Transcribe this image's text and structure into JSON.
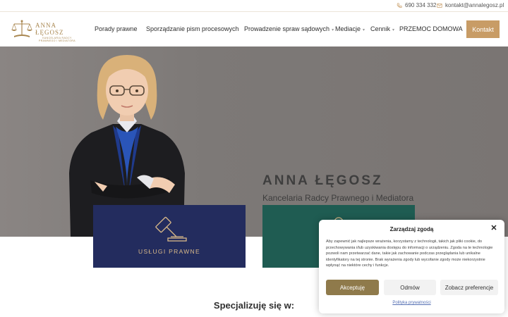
{
  "topbar": {
    "phone": "690 334 332",
    "email": "kontakt@annalegosz.pl"
  },
  "logo": {
    "name": "ANNA ŁĘGOSZ",
    "subtitle": "KANCELARIA RADCY PRAWNEGO I MEDIATORA"
  },
  "nav": {
    "items": [
      {
        "label": "Porady prawne",
        "has_dropdown": false
      },
      {
        "label": "Sporządzanie pism procesowych",
        "has_dropdown": false
      },
      {
        "label": "Prowadzenie spraw sądowych",
        "has_dropdown": true
      },
      {
        "label": "Mediacje",
        "has_dropdown": true
      },
      {
        "label": "Cennik",
        "has_dropdown": true
      },
      {
        "label": "PRZEMOC DOMOWA",
        "has_dropdown": false
      }
    ],
    "contact_button": "Kontakt"
  },
  "hero": {
    "name": "ANNA ŁĘGOSZ",
    "subtitle": "Kancelaria Radcy Prawnego i Mediatora"
  },
  "cards": {
    "legal_services": "USŁUGI PRAWNE"
  },
  "section": {
    "specialize_heading": "Specjalizuję się w:"
  },
  "cookie": {
    "title": "Zarządzaj zgodą",
    "body": "Aby zapewnić jak najlepsze wrażenia, korzystamy z technologii, takich jak pliki cookie, do przechowywania i/lub uzyskiwania dostępu do informacji o urządzeniu. Zgoda na te technologie pozwoli nam przetwarzać dane, takie jak zachowanie podczas przeglądania lub unikalne identyfikatory na tej stronie. Brak wyrażenia zgody lub wycofanie zgody może niekorzystnie wpłynąć na niektóre cechy i funkcje.",
    "accept": "Akceptuję",
    "reject": "Odmów",
    "preferences": "Zobacz preferencje",
    "policy_link": "Polityka prywatności"
  },
  "colors": {
    "accent_gold": "#c89c66",
    "navy_card": "#232c5e",
    "green_card": "#1f5c52",
    "accept_button": "#8f7a4b"
  }
}
